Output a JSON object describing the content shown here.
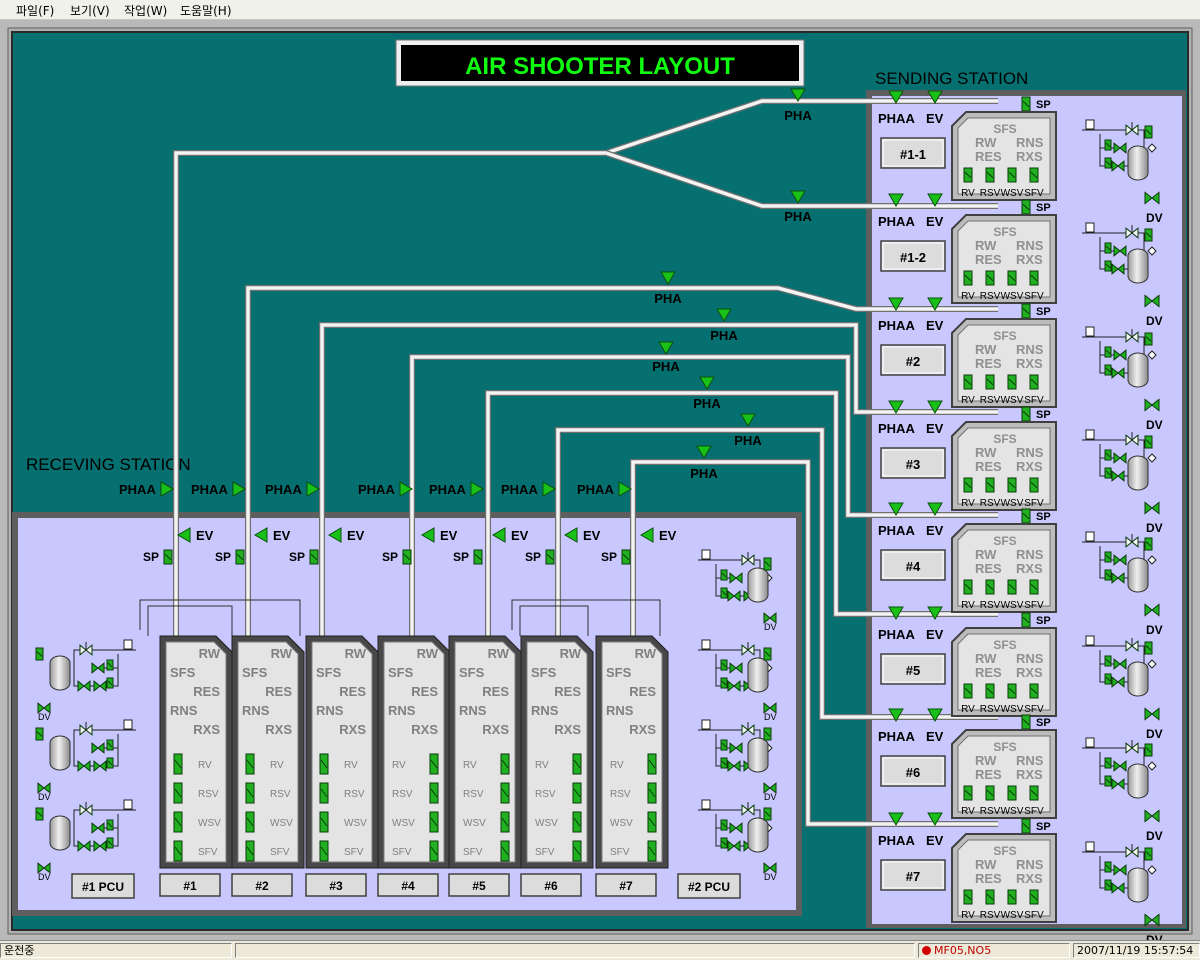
{
  "menu": {
    "file": "파일(F)",
    "view": "보기(V)",
    "work": "작업(W)",
    "help": "도움말(H)"
  },
  "title": "AIR SHOOTER LAYOUT",
  "sending_label": "SENDING STATION",
  "receiving_label": "RECEVING STATION",
  "labels": {
    "pha": "PHA",
    "phaa": "PHAA",
    "ev": "EV",
    "sp": "SP",
    "dv": "DV"
  },
  "sending_units": [
    {
      "button": "#1-1",
      "dv": "DV"
    },
    {
      "button": "#1-2",
      "dv": "DV"
    },
    {
      "button": "#2",
      "dv": "DV"
    },
    {
      "button": "#3",
      "dv": "DV"
    },
    {
      "button": "#4",
      "dv": "DV"
    },
    {
      "button": "#5",
      "dv": "DV"
    },
    {
      "button": "#6",
      "dv": "DV"
    },
    {
      "button": "#7",
      "dv": "DV"
    }
  ],
  "sending_box": {
    "top": [
      "SFS"
    ],
    "row1": [
      "RW",
      "RNS"
    ],
    "row2": [
      "RES",
      "RXS"
    ],
    "valves": [
      "RV",
      "RSV",
      "WSV",
      "SFV"
    ]
  },
  "receiving_units": [
    {
      "button": "#1"
    },
    {
      "button": "#2"
    },
    {
      "button": "#3"
    },
    {
      "button": "#4"
    },
    {
      "button": "#5"
    },
    {
      "button": "#6"
    },
    {
      "button": "#7"
    }
  ],
  "receiving_box": {
    "texts": [
      "RW",
      "SFS",
      "RES",
      "RNS",
      "RXS"
    ],
    "valves": [
      "RV",
      "RSV",
      "WSV",
      "SFV"
    ]
  },
  "pcu_buttons": [
    "#1 PCU",
    "#2 PCU"
  ],
  "status": {
    "mode": "운전중",
    "alarm": "MF05,NO5",
    "datetime": "2007/11/19 15:57:54"
  },
  "colors": {
    "background": "#067070",
    "panel": "#c8c8ff",
    "pipe": "#f4f4f4",
    "valve": "#20a020",
    "title_text": "#10ff10",
    "title_bg": "#000000"
  }
}
